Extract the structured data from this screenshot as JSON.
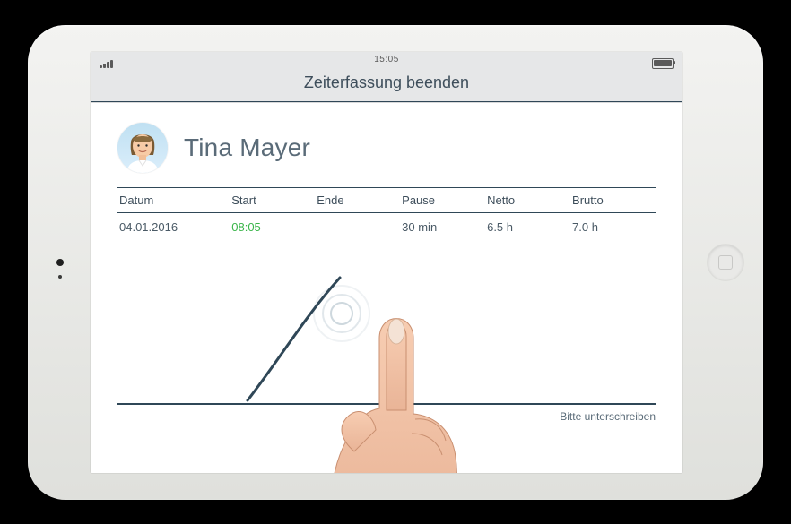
{
  "statusbar": {
    "time": "15:05"
  },
  "header": {
    "title": "Zeiterfassung beenden"
  },
  "user": {
    "name": "Tina Mayer"
  },
  "table": {
    "headers": {
      "datum": "Datum",
      "start": "Start",
      "ende": "Ende",
      "pause": "Pause",
      "netto": "Netto",
      "brutto": "Brutto"
    },
    "rows": [
      {
        "datum": "04.01.2016",
        "start": "08:05",
        "ende": "",
        "pause": "30 min",
        "netto": "6.5 h",
        "brutto": "7.0 h"
      }
    ]
  },
  "signature": {
    "hint": "Bitte unterschreiben"
  }
}
